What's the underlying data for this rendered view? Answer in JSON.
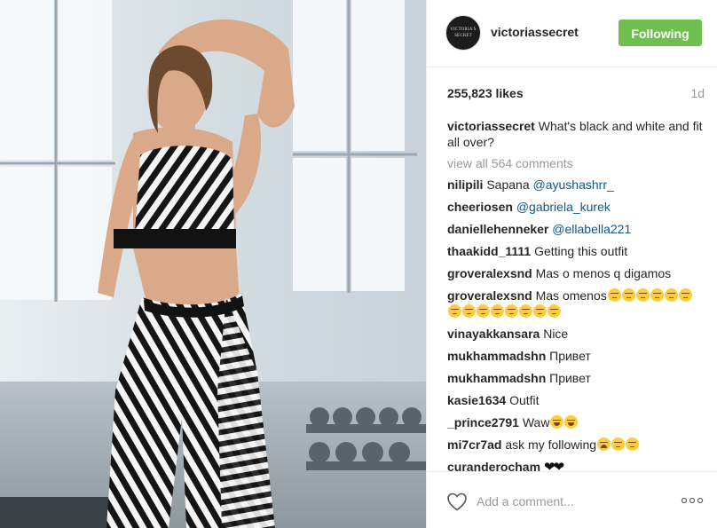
{
  "post": {
    "username": "victoriassecret",
    "avatar_text_1": "VICTORIA'S",
    "avatar_text_2": "SECRET",
    "follow_label": "Following",
    "likes": "255,823 likes",
    "time_ago": "1d"
  },
  "caption": {
    "user": "victoriassecret",
    "text": " What's black and white and fit all over?"
  },
  "view_all": "view all 564 comments",
  "comments": [
    {
      "user": "nilipili",
      "text": " Sapana ",
      "mention": "@ayushashrr_",
      "emoji": []
    },
    {
      "user": "cheeriosen",
      "text": " ",
      "mention": "@gabriela_kurek",
      "emoji": []
    },
    {
      "user": "daniellehenneker",
      "text": " ",
      "mention": "@ellabella221",
      "emoji": []
    },
    {
      "user": "thaakidd_1111",
      "text": " Getting this outfit",
      "mention": "",
      "emoji": []
    },
    {
      "user": "groveralexsnd",
      "text": " Mas o menos q digamos",
      "mention": "",
      "emoji": []
    },
    {
      "user": "groveralexsnd",
      "text": " Mas omenos",
      "mention": "",
      "emoji": [
        "unamused",
        "unamused",
        "unamused",
        "unamused",
        "unamused",
        "unamused",
        "unamused",
        "unamused",
        "unamused",
        "unamused",
        "unamused",
        "unamused",
        "unamused",
        "unamused"
      ]
    },
    {
      "user": "vinayakkansara",
      "text": " Nice",
      "mention": "",
      "emoji": []
    },
    {
      "user": "mukhammadshn",
      "text": " Привет",
      "mention": "",
      "emoji": []
    },
    {
      "user": "mukhammadshn",
      "text": " Привет",
      "mention": "",
      "emoji": []
    },
    {
      "user": "kasie1634",
      "text": " Outfit",
      "mention": "",
      "emoji": []
    },
    {
      "user": "_prince2791",
      "text": " Waw",
      "mention": "",
      "emoji": [
        "laugh",
        "laugh"
      ]
    },
    {
      "user": "mi7cr7ad",
      "text": " ask my following",
      "mention": "",
      "emoji": [
        "cry",
        "unamused",
        "unamused"
      ]
    },
    {
      "user": "curanderocham",
      "text": " ",
      "mention": "",
      "emoji": [],
      "hearts": "❤❤"
    }
  ],
  "footer": {
    "placeholder": "Add a comment...",
    "like_icon": "heart-outline-icon",
    "more_icon": "more-options-icon"
  },
  "colors": {
    "following_green": "#70c050",
    "mention_blue": "#125688",
    "muted_gray": "#999999",
    "text": "#262626"
  }
}
